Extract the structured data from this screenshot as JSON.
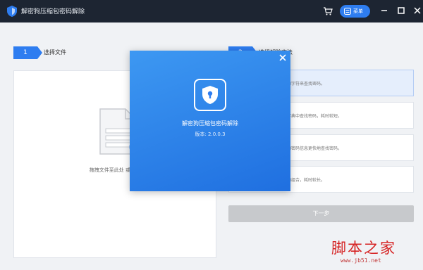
{
  "titlebar": {
    "app_title": "解密狗压缩包密码解除",
    "menu_label": "菜单"
  },
  "steps": [
    {
      "number": "1",
      "label": "选择文件"
    },
    {
      "number": "2",
      "label": "选择解除方法"
    }
  ],
  "drop_area": {
    "hint": "拖拽文件至此处 或 点击"
  },
  "methods": [
    {
      "desc": "的字符来查找密码。",
      "selected": true
    },
    {
      "desc": "字典中查找密码，耗时较短。",
      "selected": false
    },
    {
      "desc": "的密码信息更快地查找密码。",
      "selected": false
    },
    {
      "desc": "的组合，耗时较长。",
      "selected": false
    }
  ],
  "next_button": "下一步",
  "about_dialog": {
    "title": "解密狗压缩包密码解除",
    "version": "版本: 2.0.0.3"
  },
  "watermark": {
    "text": "脚本之家",
    "url": "www.jb51.net"
  },
  "colors": {
    "titlebar_bg": "#1d2532",
    "accent": "#2e7df0",
    "dialog_gradient_start": "#3d98f2",
    "dialog_gradient_end": "#1f6fe0",
    "watermark": "#d62222"
  }
}
